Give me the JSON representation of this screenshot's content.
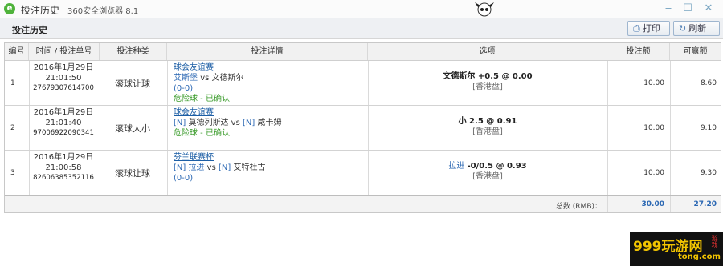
{
  "window": {
    "title": "投注历史",
    "browser": "360安全浏览器 8.1",
    "controls": {
      "minimize": "‒",
      "maximize": "☐",
      "close": "✕"
    },
    "app_icon": "e"
  },
  "toolbar": {
    "page_title": "投注历史",
    "print_label": "打印",
    "refresh_label": "刷新",
    "print_icon": "printer-icon",
    "refresh_icon": "refresh-icon"
  },
  "table": {
    "headers": [
      "编号",
      "时间 / 投注单号",
      "投注种类",
      "投注详情",
      "选项",
      "投注额",
      "可赢额"
    ],
    "rows": [
      {
        "num": "1",
        "date": "2016年1月29日",
        "time": "21:01:50",
        "bet_id": "27679307614700",
        "type": "滚球让球",
        "league": "球会友谊赛",
        "home_tag": "",
        "home": "艾斯堡",
        "vs": "vs",
        "away_tag": "",
        "away": "文德斯尔",
        "score": "(0-0)",
        "status": "危险球 - 已确认",
        "pick_team": "",
        "pick": "文德斯尔 +0.5 @ 0.00",
        "market": "[香港盘]",
        "stake": "10.00",
        "win": "8.60"
      },
      {
        "num": "2",
        "date": "2016年1月29日",
        "time": "21:01:40",
        "bet_id": "97006922090341",
        "type": "滚球大小",
        "league": "球会友谊赛",
        "home_tag": "[N]",
        "home": "莫德列斯达",
        "vs": "vs",
        "away_tag": "[N]",
        "away": "咸卡姆",
        "score": "",
        "status": "危险球 - 已确认",
        "pick_team": "",
        "pick": "小 2.5 @ 0.91",
        "market": "[香港盘]",
        "stake": "10.00",
        "win": "9.10"
      },
      {
        "num": "3",
        "date": "2016年1月29日",
        "time": "21:00:58",
        "bet_id": "82606385352116",
        "type": "滚球让球",
        "league": "芬兰联赛杯",
        "home_tag": "[N]",
        "home": "拉进",
        "vs": "vs",
        "away_tag": "[N]",
        "away": "艾特杜古",
        "score": "(0-0)",
        "status": "",
        "pick_team": "拉进",
        "pick": "-0/0.5 @ 0.93",
        "market": "[香港盘]",
        "stake": "10.00",
        "win": "9.30"
      }
    ],
    "total_label": "总数 (RMB)：",
    "total_stake": "30.00",
    "total_win": "27.20"
  },
  "watermark": {
    "text": "999玩游网",
    "domain": "tong.com",
    "side": "游戏"
  }
}
